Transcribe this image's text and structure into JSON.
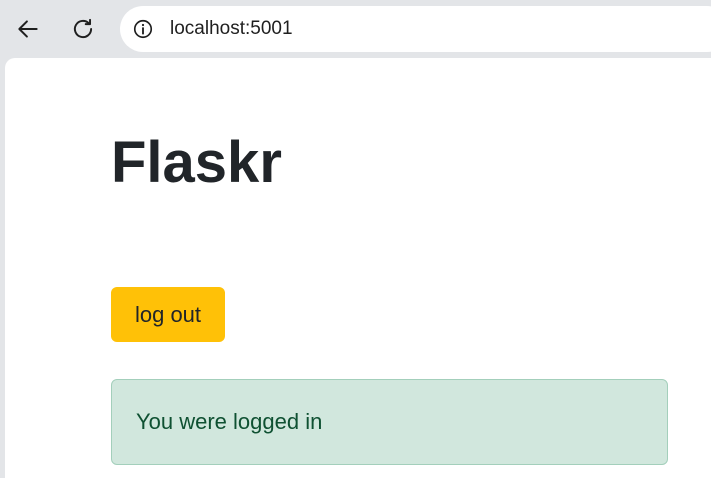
{
  "browser": {
    "url": "localhost:5001",
    "back_icon": "arrow-left-icon",
    "reload_icon": "reload-icon",
    "info_icon": "info-icon"
  },
  "page": {
    "title": "Flaskr",
    "logout_label": "log out",
    "flash_message": "You were logged in"
  },
  "colors": {
    "chrome_bg": "#e3e5e8",
    "title": "#212529",
    "warning_button": "#ffc107",
    "flash_bg": "#d1e7dd",
    "flash_border": "#a3cfbb",
    "flash_text": "#0f5132"
  }
}
